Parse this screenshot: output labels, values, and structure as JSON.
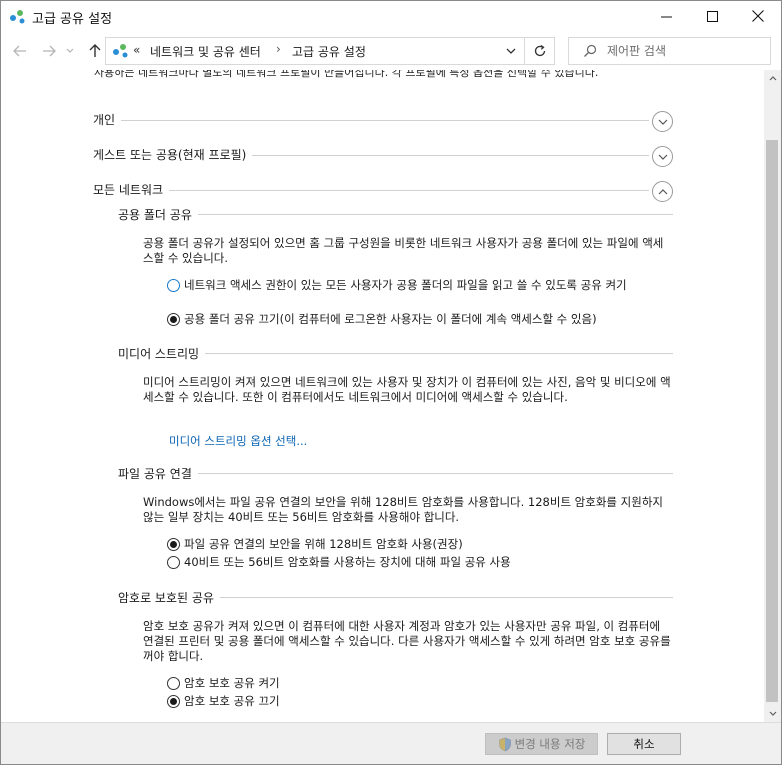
{
  "window": {
    "title": "고급 공유 설정"
  },
  "address": {
    "overflow": "«",
    "crumbs": [
      "네트워크 및 공유 센터",
      "고급 공유 설정"
    ],
    "separator": "›"
  },
  "search": {
    "placeholder": "제어판 검색"
  },
  "intro_text": "사용하는 네트워크마다 별도의 네트워크 프로필이 만들어집니다. 각 프로필에 특정 옵션을 선택할 수 있습니다.",
  "sections": {
    "private": {
      "title": "개인"
    },
    "guest": {
      "title": "게스트 또는 공용(현재 프로필)"
    },
    "all": {
      "title": "모든 네트워크"
    }
  },
  "public_folder": {
    "title": "공용 폴더 공유",
    "description": "공용 폴더 공유가 설정되어 있으면 홈 그룹 구성원을 비롯한 네트워크 사용자가 공용 폴더에 있는 파일에 액세스할 수 있습니다.",
    "options": [
      {
        "label": "네트워크 액세스 권한이 있는 모든 사용자가 공용 폴더의 파일을 읽고 쓸 수 있도록 공유 켜기",
        "checked": false
      },
      {
        "label": "공용 폴더 공유 끄기(이 컴퓨터에 로그온한 사용자는 이 폴더에 계속 액세스할 수 있음)",
        "checked": true
      }
    ]
  },
  "media": {
    "title": "미디어 스트리밍",
    "description": "미디어 스트리밍이 켜져 있으면 네트워크에 있는 사용자 및 장치가 이 컴퓨터에 있는 사진, 음악 및 비디오에 액세스할 수 있습니다. 또한 이 컴퓨터에서도 네트워크에서 미디어에 액세스할 수 있습니다.",
    "link": "미디어 스트리밍 옵션 선택..."
  },
  "file_sharing": {
    "title": "파일 공유 연결",
    "description": "Windows에서는 파일 공유 연결의 보안을 위해 128비트 암호화를 사용합니다. 128비트 암호화를 지원하지 않는 일부 장치는 40비트 또는 56비트 암호화를 사용해야 합니다.",
    "options": [
      {
        "label": "파일 공유 연결의 보안을 위해 128비트 암호화 사용(권장)",
        "checked": true
      },
      {
        "label": "40비트 또는 56비트 암호화를 사용하는 장치에 대해 파일 공유 사용",
        "checked": false
      }
    ]
  },
  "password": {
    "title": "암호로 보호된 공유",
    "description": "암호 보호 공유가 켜져 있으면 이 컴퓨터에 대한 사용자 계정과 암호가 있는 사용자만 공유 파일, 이 컴퓨터에 연결된 프린터 및 공용 폴더에 액세스할 수 있습니다. 다른 사용자가 액세스할 수 있게 하려면 암호 보호 공유를 꺼야 합니다.",
    "options": [
      {
        "label": "암호 보호 공유 켜기",
        "checked": false
      },
      {
        "label": "암호 보호 공유 끄기",
        "checked": true
      }
    ]
  },
  "footer": {
    "save_label": "변경 내용 저장",
    "cancel_label": "취소"
  },
  "colors": {
    "accent": "#1979ca",
    "link": "#0a64b4",
    "footer_bg": "#f0f0f0"
  }
}
